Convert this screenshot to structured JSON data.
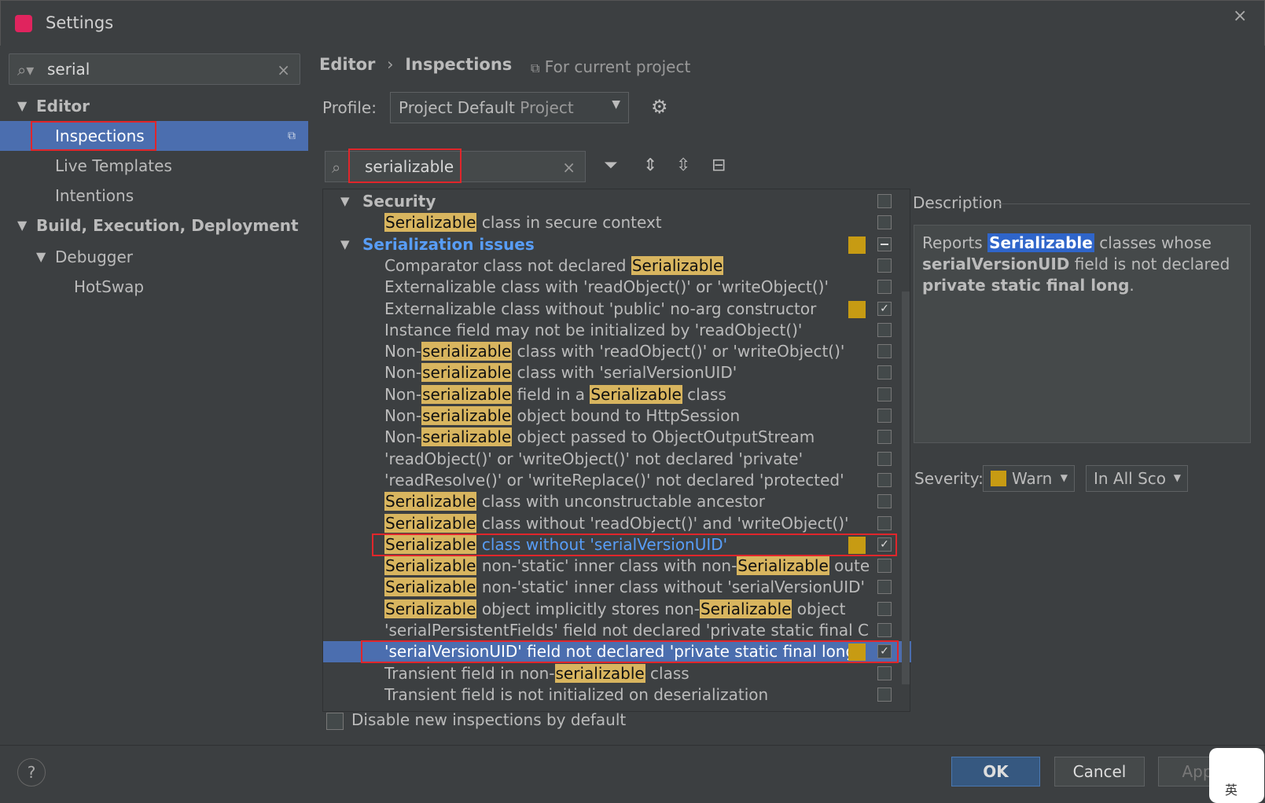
{
  "window": {
    "title": "Settings",
    "close": "×"
  },
  "search": {
    "value": "serial",
    "clear": "×"
  },
  "tree": [
    {
      "label": "Editor",
      "level": 0,
      "expanded": true,
      "bold": true
    },
    {
      "label": "Inspections",
      "level": 1,
      "selected": true
    },
    {
      "label": "Live Templates",
      "level": 1
    },
    {
      "label": "Intentions",
      "level": 1
    },
    {
      "label": "Build, Execution, Deployment",
      "level": 0,
      "expanded": true,
      "bold": true
    },
    {
      "label": "Debugger",
      "level": 1,
      "expanded": true
    },
    {
      "label": "HotSwap",
      "level": 2
    }
  ],
  "breadcrumb": {
    "part1": "Editor",
    "sep": "›",
    "part2": "Inspections",
    "scope": "For current project"
  },
  "profile": {
    "label": "Profile:",
    "value": "Project Default",
    "sub": "Project"
  },
  "filter": {
    "value": "serializable",
    "clear": "×"
  },
  "inspections": [
    {
      "kind": "group",
      "label": "Security",
      "checked": false
    },
    {
      "kind": "item",
      "parts": [
        {
          "t": "Serializable",
          "h": true
        },
        {
          "t": " class in secure context"
        }
      ],
      "checked": false
    },
    {
      "kind": "group",
      "label": "Serialization issues",
      "blue": true,
      "swatch": true,
      "checked": "partial"
    },
    {
      "kind": "item",
      "parts": [
        {
          "t": "Comparator class not declared "
        },
        {
          "t": "Serializable",
          "h": true
        }
      ],
      "checked": false
    },
    {
      "kind": "item",
      "parts": [
        {
          "t": "Externalizable class with 'readObject()' or 'writeObject()'"
        }
      ],
      "checked": false
    },
    {
      "kind": "item",
      "parts": [
        {
          "t": "Externalizable class without 'public' no-arg constructor"
        }
      ],
      "swatch": true,
      "checked": true
    },
    {
      "kind": "item",
      "parts": [
        {
          "t": "Instance field may not be initialized by 'readObject()'"
        }
      ],
      "checked": false
    },
    {
      "kind": "item",
      "parts": [
        {
          "t": "Non-"
        },
        {
          "t": "serializable",
          "h": true
        },
        {
          "t": " class with 'readObject()' or 'writeObject()'"
        }
      ],
      "checked": false
    },
    {
      "kind": "item",
      "parts": [
        {
          "t": "Non-"
        },
        {
          "t": "serializable",
          "h": true
        },
        {
          "t": " class with 'serialVersionUID'"
        }
      ],
      "checked": false
    },
    {
      "kind": "item",
      "parts": [
        {
          "t": "Non-"
        },
        {
          "t": "serializable",
          "h": true
        },
        {
          "t": " field in a "
        },
        {
          "t": "Serializable",
          "h": true
        },
        {
          "t": " class"
        }
      ],
      "checked": false
    },
    {
      "kind": "item",
      "parts": [
        {
          "t": "Non-"
        },
        {
          "t": "serializable",
          "h": true
        },
        {
          "t": " object bound to HttpSession"
        }
      ],
      "checked": false
    },
    {
      "kind": "item",
      "parts": [
        {
          "t": "Non-"
        },
        {
          "t": "serializable",
          "h": true
        },
        {
          "t": " object passed to ObjectOutputStream"
        }
      ],
      "checked": false
    },
    {
      "kind": "item",
      "parts": [
        {
          "t": "'readObject()' or 'writeObject()' not declared 'private'"
        }
      ],
      "checked": false
    },
    {
      "kind": "item",
      "parts": [
        {
          "t": "'readResolve()' or 'writeReplace()' not declared 'protected'"
        }
      ],
      "checked": false
    },
    {
      "kind": "item",
      "parts": [
        {
          "t": "Serializable",
          "h": true
        },
        {
          "t": " class with unconstructable ancestor"
        }
      ],
      "checked": false
    },
    {
      "kind": "item",
      "parts": [
        {
          "t": "Serializable",
          "h": true
        },
        {
          "t": " class without 'readObject()' and 'writeObject()'"
        }
      ],
      "checked": false
    },
    {
      "kind": "item",
      "parts": [
        {
          "t": "Serializable",
          "h": true
        },
        {
          "t": " class without 'serialVersionUID'",
          "blue": true
        }
      ],
      "swatch": true,
      "checked": true,
      "boxed": true
    },
    {
      "kind": "item",
      "parts": [
        {
          "t": "Serializable",
          "h": true
        },
        {
          "t": " non-'static' inner class with non-"
        },
        {
          "t": "Serializable",
          "h": true
        },
        {
          "t": " oute"
        }
      ],
      "checked": false
    },
    {
      "kind": "item",
      "parts": [
        {
          "t": "Serializable",
          "h": true
        },
        {
          "t": " non-'static' inner class without 'serialVersionUID'"
        }
      ],
      "checked": false
    },
    {
      "kind": "item",
      "parts": [
        {
          "t": "Serializable",
          "h": true
        },
        {
          "t": " object implicitly stores non-"
        },
        {
          "t": "Serializable",
          "h": true
        },
        {
          "t": " object"
        }
      ],
      "checked": false
    },
    {
      "kind": "item",
      "parts": [
        {
          "t": "'serialPersistentFields' field not declared 'private static final C"
        }
      ],
      "checked": false
    },
    {
      "kind": "item",
      "parts": [
        {
          "t": "'serialVersionUID' field not declared 'private static final long'"
        }
      ],
      "swatch": true,
      "checked": true,
      "selected": true,
      "boxed": true
    },
    {
      "kind": "item",
      "parts": [
        {
          "t": "Transient field in non-"
        },
        {
          "t": "serializable",
          "h": true
        },
        {
          "t": " class"
        }
      ],
      "checked": false
    },
    {
      "kind": "item",
      "parts": [
        {
          "t": "Transient field is not initialized on deserialization"
        }
      ],
      "checked": false
    }
  ],
  "description": {
    "label": "Description",
    "line1_a": "Reports ",
    "line1_b": "Serializable",
    "line1_c": " classes whose",
    "line2_a": "serialVersionUID",
    "line2_b": " field is not declared",
    "line3_a": "private static final long",
    "line3_b": "."
  },
  "severity": {
    "label": "Severity:",
    "value": "Warn",
    "scope": "In All Sco"
  },
  "bottom": {
    "disable_label": "Disable new inspections by default",
    "help": "?",
    "ok": "OK",
    "cancel": "Cancel",
    "apply": "App"
  },
  "ime": {
    "text": "英"
  }
}
